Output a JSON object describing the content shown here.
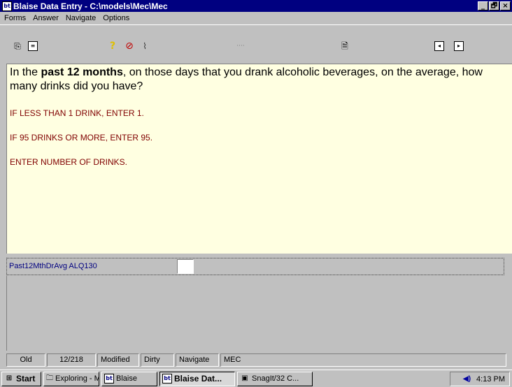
{
  "window": {
    "title": "Blaise Data Entry - C:\\models\\Mec\\Mec",
    "app_icon": "blaise-icon",
    "minimize_label": "_",
    "maximize_label": "🗗",
    "close_label": "×"
  },
  "menu": {
    "items": [
      {
        "label": "Forms"
      },
      {
        "label": "Answer"
      },
      {
        "label": "Navigate"
      },
      {
        "label": "Options"
      }
    ]
  },
  "toolbar": {
    "dots": "····"
  },
  "question": {
    "line1_prefix": "In the ",
    "line1_bold": "past 12 months",
    "line1_suffix": ", on those days that you drank alcoholic beverages, on the average, how many drinks did you have?",
    "instructions": [
      "IF LESS THAN 1 DRINK, ENTER 1.",
      "IF 95 DRINKS OR MORE, ENTER 95.",
      "ENTER NUMBER OF DRINKS."
    ]
  },
  "field": {
    "label": "Past12MthDrAvg ALQ130",
    "value": ""
  },
  "status": {
    "cells": [
      "Old",
      "12/218",
      "Modified",
      "Dirty",
      "Navigate",
      "MEC"
    ]
  },
  "taskbar": {
    "start_label": "Start",
    "tasks": [
      {
        "label": "Exploring - M...",
        "icon": "folder-icon"
      },
      {
        "label": "Blaise",
        "icon": "blaise-icon"
      },
      {
        "label": "Blaise Dat...",
        "icon": "blaise-icon"
      },
      {
        "label": "SnagIt/32 C...",
        "icon": "snagit-icon"
      }
    ],
    "clock": "4:13 PM"
  }
}
